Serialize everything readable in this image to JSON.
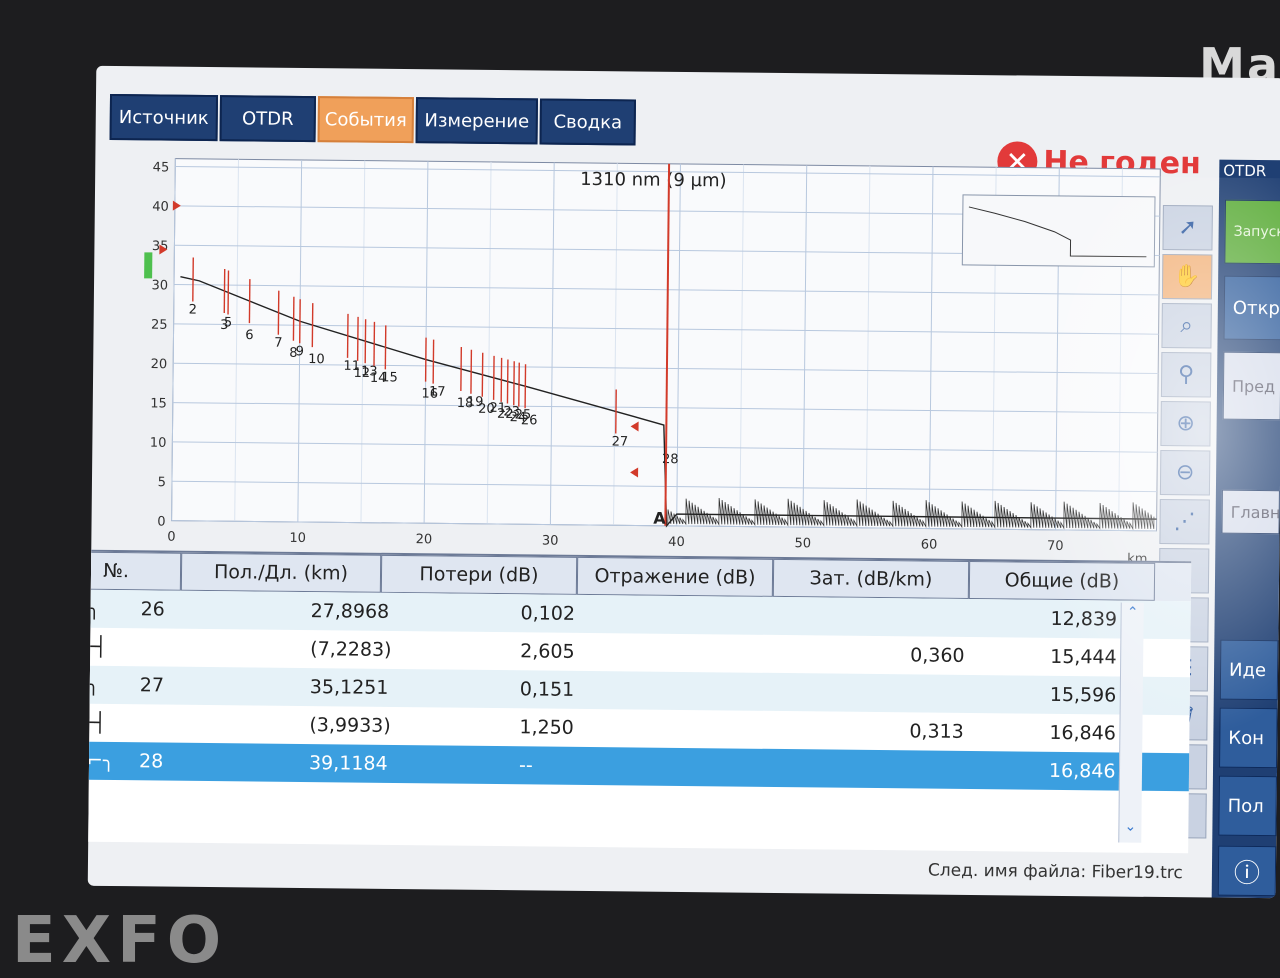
{
  "device": {
    "brand": "Ma",
    "logo": "EXFO"
  },
  "tabs": [
    "Источник",
    "OTDR",
    "События",
    "Измерение",
    "Сводка"
  ],
  "active_tab": "События",
  "status": {
    "text": "Не годен",
    "color": "#e23a3a"
  },
  "chart": {
    "label": "1310 nm (9 µm)",
    "x_unit": "km",
    "x_ticks": [
      "0",
      "10",
      "20",
      "30",
      "40",
      "50",
      "60",
      "70"
    ],
    "y_ticks": [
      "0",
      "5",
      "10",
      "15",
      "20",
      "25",
      "30",
      "35",
      "40",
      "45"
    ],
    "marker": "A",
    "event_labels": [
      "2",
      "3",
      "5",
      "6",
      "7",
      "8",
      "9",
      "10",
      "11",
      "12",
      "13",
      "14",
      "15",
      "16",
      "17",
      "18",
      "19",
      "20",
      "21",
      "22",
      "23",
      "24",
      "25",
      "26",
      "27",
      "28"
    ]
  },
  "chart_data": {
    "type": "line",
    "title": "1310 nm (9 µm)",
    "xlabel": "km",
    "ylabel": "",
    "xlim": [
      0,
      78
    ],
    "ylim": [
      0,
      46
    ],
    "grid": true,
    "series": [
      {
        "x": [
          0.5,
          2,
          10,
          20,
          28,
          35,
          38.9,
          39.2,
          40,
          50,
          60,
          70,
          78
        ],
        "y": [
          31,
          30.5,
          25.5,
          20.8,
          17.5,
          14.5,
          12.8,
          0,
          1.5,
          1.5,
          1.5,
          1.5,
          1.5
        ]
      }
    ],
    "events": [
      {
        "label": "2",
        "x": 1.5
      },
      {
        "label": "3",
        "x": 4.0
      },
      {
        "label": "5",
        "x": 4.3
      },
      {
        "label": "6",
        "x": 6.0
      },
      {
        "label": "7",
        "x": 8.3
      },
      {
        "label": "8",
        "x": 9.5
      },
      {
        "label": "9",
        "x": 10.0
      },
      {
        "label": "10",
        "x": 11.0
      },
      {
        "label": "11",
        "x": 13.8
      },
      {
        "label": "12",
        "x": 14.6
      },
      {
        "label": "13",
        "x": 15.2
      },
      {
        "label": "14",
        "x": 15.9
      },
      {
        "label": "15",
        "x": 16.8
      },
      {
        "label": "16",
        "x": 20.0
      },
      {
        "label": "17",
        "x": 20.6
      },
      {
        "label": "18",
        "x": 22.8
      },
      {
        "label": "19",
        "x": 23.6
      },
      {
        "label": "20",
        "x": 24.5
      },
      {
        "label": "21",
        "x": 25.4
      },
      {
        "label": "22",
        "x": 26.0
      },
      {
        "label": "23",
        "x": 26.5
      },
      {
        "label": "24",
        "x": 27.0
      },
      {
        "label": "25",
        "x": 27.4
      },
      {
        "label": "26",
        "x": 27.9
      },
      {
        "label": "27",
        "x": 35.1
      },
      {
        "label": "28",
        "x": 39.1
      }
    ]
  },
  "toolbar_icons": [
    "cursor-icon",
    "hand-icon",
    "zoom-fit-icon",
    "zoom-icon",
    "zoom-in-icon",
    "zoom-out-icon",
    "auto-icon",
    "up-icon",
    "down-icon",
    "table-icon",
    "trash-icon",
    "pencil-icon",
    "refresh-icon"
  ],
  "right_panel": {
    "title": "OTDR",
    "buttons": [
      "Запуск с ведущ.",
      "Откр",
      "Пред",
      "Главн",
      "Иде",
      "Кон",
      "Пол"
    ]
  },
  "table": {
    "headers": [
      "№.",
      "Пол./Дл. (km)",
      "Потери (dB)",
      "Отражение (dB)",
      "Зат. (dB/km)",
      "Общие (dB)"
    ],
    "rows": [
      {
        "icon": "step",
        "no": "26",
        "pos": "27,8968",
        "loss": "0,102",
        "refl": "",
        "att": "",
        "total": "12,839"
      },
      {
        "icon": "span",
        "no": "",
        "pos": "(7,2283)",
        "loss": "2,605",
        "refl": "",
        "att": "0,360",
        "total": "15,444"
      },
      {
        "icon": "step",
        "no": "27",
        "pos": "35,1251",
        "loss": "0,151",
        "refl": "",
        "att": "",
        "total": "15,596"
      },
      {
        "icon": "span",
        "no": "",
        "pos": "(3,9933)",
        "loss": "1,250",
        "refl": "",
        "att": "0,313",
        "total": "16,846"
      },
      {
        "icon": "end",
        "no": "28",
        "pos": "39,1184",
        "loss": "--",
        "refl": "",
        "att": "",
        "total": "16,846"
      }
    ]
  },
  "footer": "След. имя файла: Fiber19.trc"
}
